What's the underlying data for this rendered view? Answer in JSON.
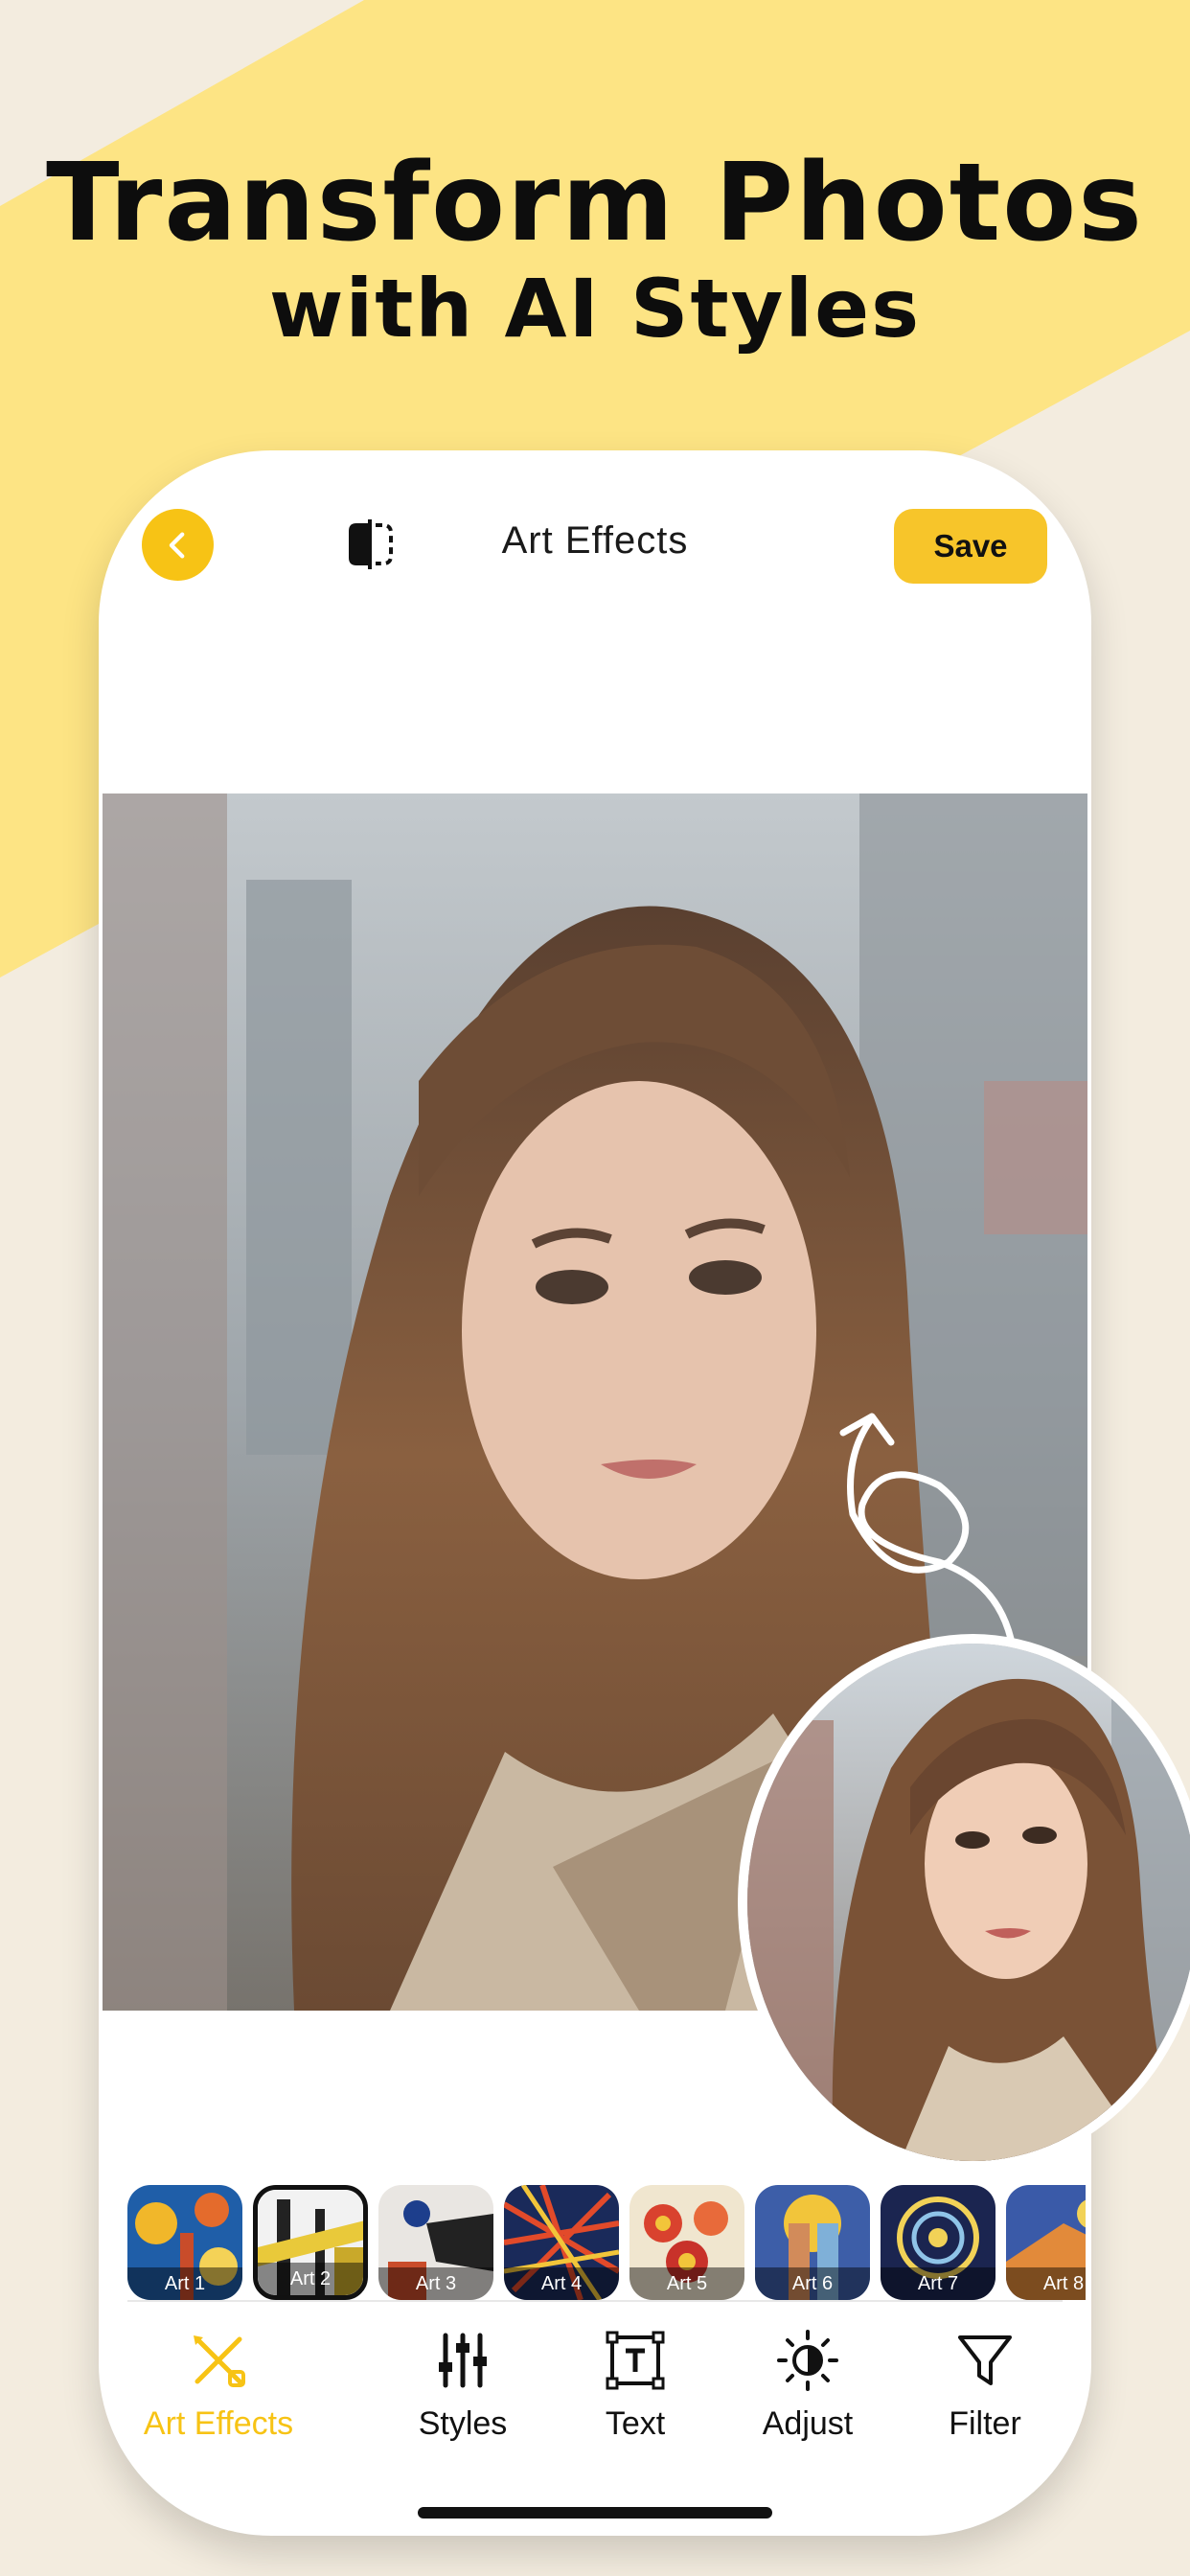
{
  "headline": {
    "line1": "Transform Photos",
    "line2": "with AI Styles"
  },
  "topbar": {
    "title": "Art Effects",
    "save_label": "Save",
    "back_icon": "chevron-left-icon",
    "compare_icon": "compare-split-icon"
  },
  "styles": [
    {
      "label": "Art 1",
      "selected": false
    },
    {
      "label": "Art 2",
      "selected": true
    },
    {
      "label": "Art 3",
      "selected": false
    },
    {
      "label": "Art 4",
      "selected": false
    },
    {
      "label": "Art 5",
      "selected": false
    },
    {
      "label": "Art 6",
      "selected": false
    },
    {
      "label": "Art 7",
      "selected": false
    },
    {
      "label": "Art 8",
      "selected": false
    }
  ],
  "tabs": [
    {
      "label": "Art Effects",
      "icon": "brush-pencil-icon",
      "active": true
    },
    {
      "label": "Styles",
      "icon": "sliders-icon",
      "active": false
    },
    {
      "label": "Text",
      "icon": "text-box-icon",
      "active": false
    },
    {
      "label": "Adjust",
      "icon": "contrast-icon",
      "active": false
    },
    {
      "label": "Filter",
      "icon": "funnel-icon",
      "active": false
    }
  ],
  "colors": {
    "accent": "#F7C315",
    "background": "#F3ECDF",
    "banner": "#FDE484"
  }
}
